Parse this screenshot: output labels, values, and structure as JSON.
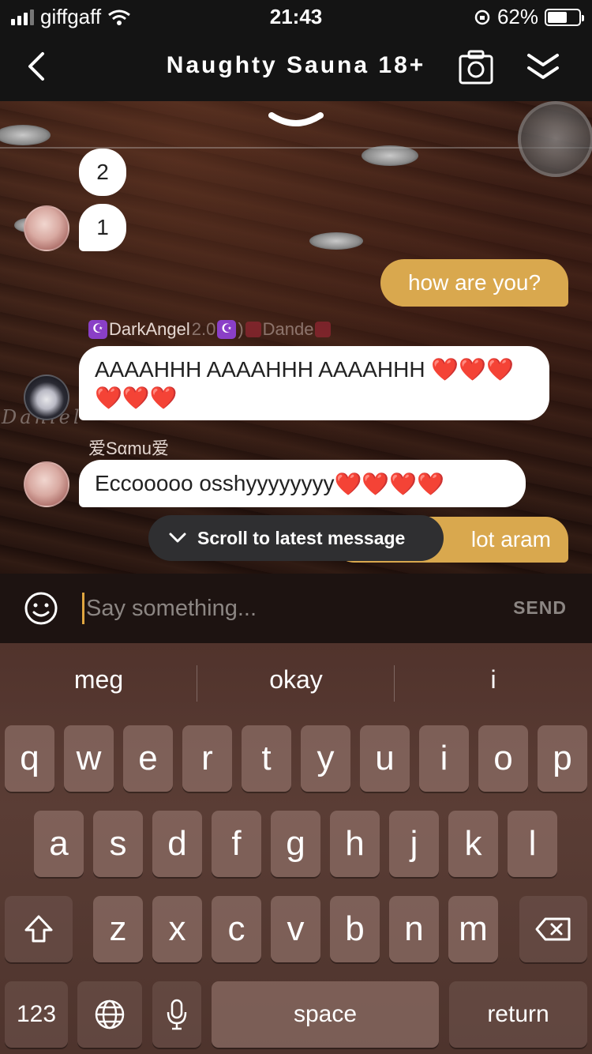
{
  "status_bar": {
    "carrier": "giffgaff",
    "time": "21:43",
    "battery_percent": "62%",
    "battery_level": 0.62,
    "icons": [
      "signal-icon",
      "wifi-icon",
      "rotation-lock-icon",
      "battery-icon"
    ]
  },
  "nav": {
    "title": "Naughty Sauna 18+",
    "icons": [
      "back-chevron-icon",
      "camera-icon",
      "collapse-double-chevron-icon"
    ]
  },
  "chat": {
    "watermark": "Daniel",
    "messages": [
      {
        "side": "left",
        "text": "2"
      },
      {
        "side": "left",
        "text": "1"
      },
      {
        "side": "right",
        "text": "how are you?"
      },
      {
        "side": "left",
        "sender_parts": [
          "DarkAngel",
          "2.0",
          ")",
          "Dande"
        ],
        "text": "AAAAHHH AAAAHHH AAAAHHH",
        "hearts": "❤️❤️❤️❤️❤️❤️"
      },
      {
        "side": "left",
        "sender": "爱Sαmu爱",
        "text": "Eccooooo osshyyyyyyyy",
        "hearts": "❤️❤️❤️❤️"
      },
      {
        "side": "right",
        "text": "lot aram"
      }
    ],
    "scroll_pill": "Scroll to latest message"
  },
  "composer": {
    "placeholder": "Say something...",
    "send_label": "SEND"
  },
  "keyboard": {
    "suggestions": [
      "meg",
      "okay",
      "i"
    ],
    "row1": [
      "q",
      "w",
      "e",
      "r",
      "t",
      "y",
      "u",
      "i",
      "o",
      "p"
    ],
    "row2": [
      "a",
      "s",
      "d",
      "f",
      "g",
      "h",
      "j",
      "k",
      "l"
    ],
    "row3": [
      "z",
      "x",
      "c",
      "v",
      "b",
      "n",
      "m"
    ],
    "numbers_label": "123",
    "space_label": "space",
    "return_label": "return"
  },
  "colors": {
    "accent_gold": "#d9a84e",
    "heart_red": "#e0202b",
    "bar_dark": "#141414"
  }
}
